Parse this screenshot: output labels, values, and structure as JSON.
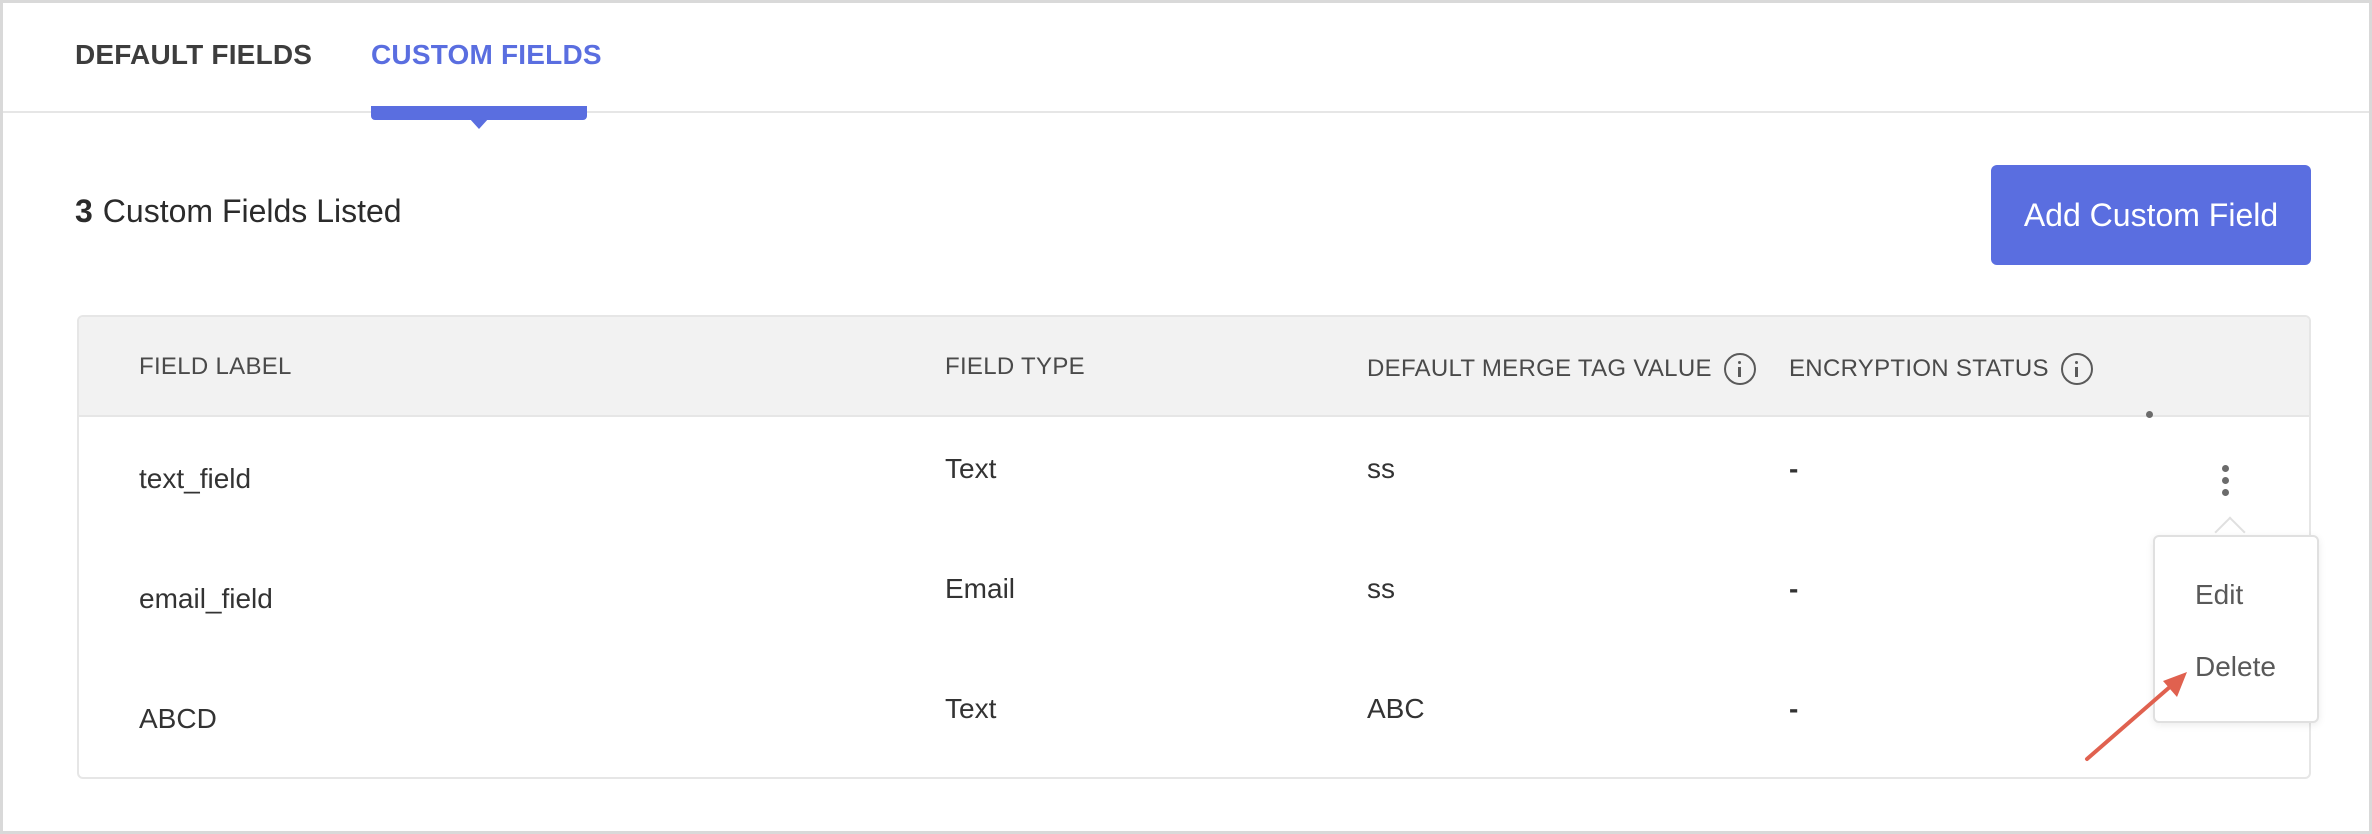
{
  "tabs": {
    "default_label": "DEFAULT FIELDS",
    "custom_label": "CUSTOM FIELDS",
    "active": "custom"
  },
  "summary": {
    "count": "3",
    "text": "Custom Fields Listed"
  },
  "actions": {
    "add_label": "Add Custom Field"
  },
  "table": {
    "headers": {
      "field_label": "FIELD LABEL",
      "field_type": "FIELD TYPE",
      "default_merge_tag": "DEFAULT MERGE TAG VALUE",
      "encryption_status": "ENCRYPTION STATUS"
    },
    "rows": [
      {
        "label": "text_field",
        "type": "Text",
        "merge_value": "ss",
        "encryption": "-"
      },
      {
        "label": "email_field",
        "type": "Email",
        "merge_value": "ss",
        "encryption": "-"
      },
      {
        "label": "ABCD",
        "type": "Text",
        "merge_value": "ABC",
        "encryption": "-"
      }
    ]
  },
  "row_menu": {
    "edit_label": "Edit",
    "delete_label": "Delete"
  },
  "icons": {
    "info": "info-icon",
    "more": "kebab-menu-icon",
    "annotation": "arrow-icon"
  },
  "colors": {
    "accent": "#5a6ee0",
    "header_bg": "#f2f2f2",
    "annotation": "#e0614f"
  }
}
